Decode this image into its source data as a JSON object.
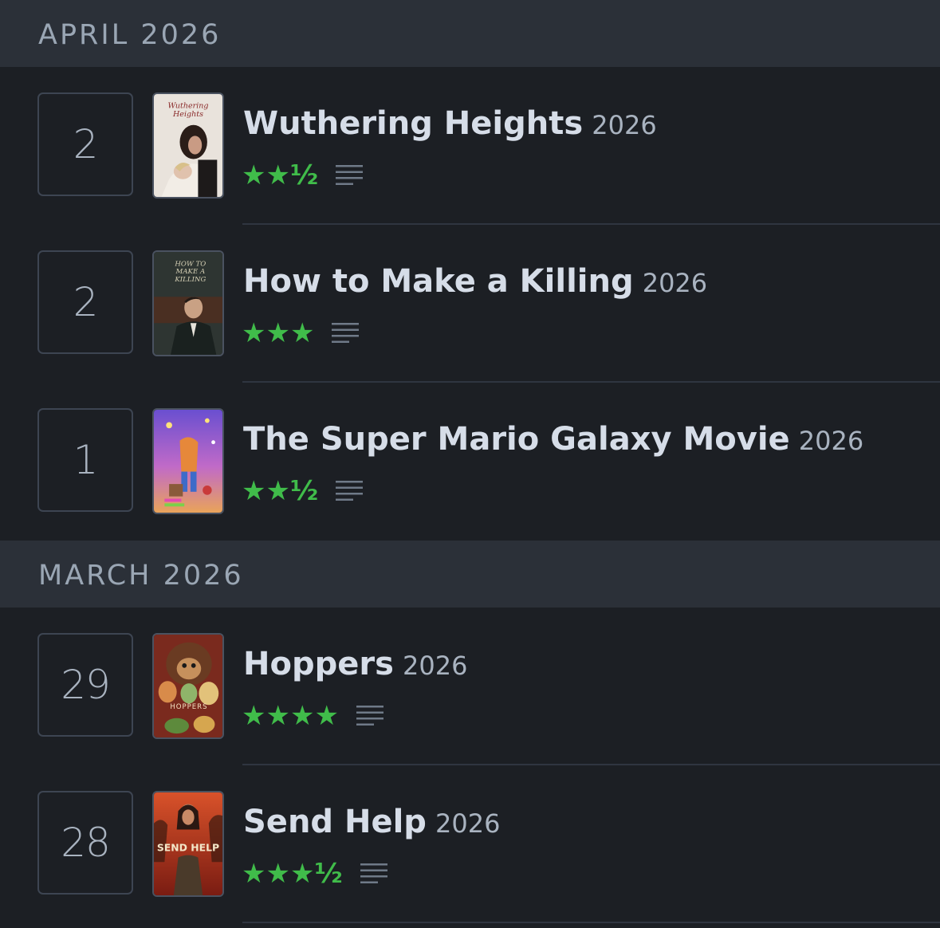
{
  "months": [
    {
      "label": "APRIL 2026",
      "entries": [
        {
          "day": "2",
          "title": "Wuthering Heights",
          "year": "2026",
          "rating": "★★½",
          "poster": "wuthering-heights-poster"
        },
        {
          "day": "2",
          "title": "How to Make a Killing",
          "year": "2026",
          "rating": "★★★",
          "poster": "how-to-make-a-killing-poster"
        },
        {
          "day": "1",
          "title": "The Super Mario Galaxy Movie",
          "year": "2026",
          "rating": "★★½",
          "poster": "super-mario-galaxy-poster"
        }
      ]
    },
    {
      "label": "MARCH 2026",
      "entries": [
        {
          "day": "29",
          "title": "Hoppers",
          "year": "2026",
          "rating": "★★★★",
          "poster": "hoppers-poster"
        },
        {
          "day": "28",
          "title": "Send Help",
          "year": "2026",
          "rating": "★★★½",
          "poster": "send-help-poster"
        }
      ]
    }
  ],
  "posters": {
    "wuthering_text": "Wuthering Heights",
    "killing_text": "HOW TO MAKE A KILLING",
    "hoppers_text": "HOPPERS",
    "send_help_text": "SEND HELP"
  },
  "colors": {
    "background": "#1c1f24",
    "month_header_bg": "#2b3038",
    "star_green": "#40bc4a",
    "title_text": "#d6dde8"
  },
  "icons": {
    "review": "review-lines-icon"
  }
}
